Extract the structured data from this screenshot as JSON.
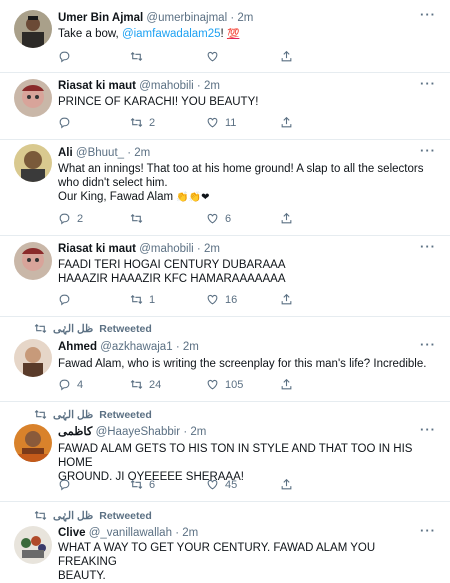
{
  "tweets": [
    {
      "name": "Umer Bin Ajmal",
      "handle": "@umerbinajmal",
      "time": "2m",
      "text_prefix": "Take a bow, ",
      "mention": "@iamfawadalam25",
      "text_suffix": "! ",
      "emoji": "💯",
      "replies": "",
      "retweets": "",
      "likes": ""
    },
    {
      "name": "Riasat ki maut",
      "handle": "@mahobili",
      "time": "2m",
      "line1": "PRINCE OF KARACHI! YOU BEAUTY!",
      "replies": "",
      "retweets": "2",
      "likes": "11"
    },
    {
      "name": "Ali",
      "handle": "@Bhuut_",
      "time": "2m",
      "line1": "What an innings! That too at his home ground! A slap to all the selectors",
      "line2": "who didn't select him.",
      "line3": "Our King, Fawad Alam",
      "emoji": "👏👏❤",
      "replies": "2",
      "retweets": "",
      "likes": "6"
    },
    {
      "name": "Riasat ki maut",
      "handle": "@mahobili",
      "time": "2m",
      "line1": "FAADI TERI HOGAI CENTURY DUBARAAA",
      "line2": "HAAAZIR HAAAZIR KFC HAMARAAAAAAA",
      "replies": "",
      "retweets": "1",
      "likes": "16"
    },
    {
      "retweeted_by": "ظل الہٰی",
      "retweeted_label": "Retweeted",
      "name": "Ahmed",
      "handle": "@azkhawaja1",
      "time": "2m",
      "line1": "Fawad Alam, who is writing the screenplay for this man's life? Incredible.",
      "replies": "4",
      "retweets": "24",
      "likes": "105"
    },
    {
      "retweeted_by": "ظل الہٰی",
      "retweeted_label": "Retweeted",
      "name": "کاظمی",
      "handle": "@HaayeShabbir",
      "time": "2m",
      "line1": "FAWAD ALAM GETS TO HIS TON IN STYLE AND THAT TOO IN HIS HOME",
      "line2": "GROUND. JI OYEEEEE SHERAAA!",
      "replies": "",
      "retweets": "6",
      "likes": "45"
    },
    {
      "retweeted_by": "ظل الہٰی",
      "retweeted_label": "Retweeted",
      "name": "Clive",
      "handle": "@_vanillawallah",
      "time": "2m",
      "line1": "WHAT A WAY TO GET YOUR CENTURY. FAWAD ALAM YOU FREAKING",
      "line2": "BEAUTY."
    }
  ],
  "icons": {
    "reply": "reply-icon",
    "retweet": "retweet-icon",
    "like": "heart-icon",
    "share": "share-icon",
    "more": "more-icon"
  },
  "colors": {
    "link": "#1da1f2",
    "muted": "#5b7083",
    "divider": "#e6ecf0"
  }
}
